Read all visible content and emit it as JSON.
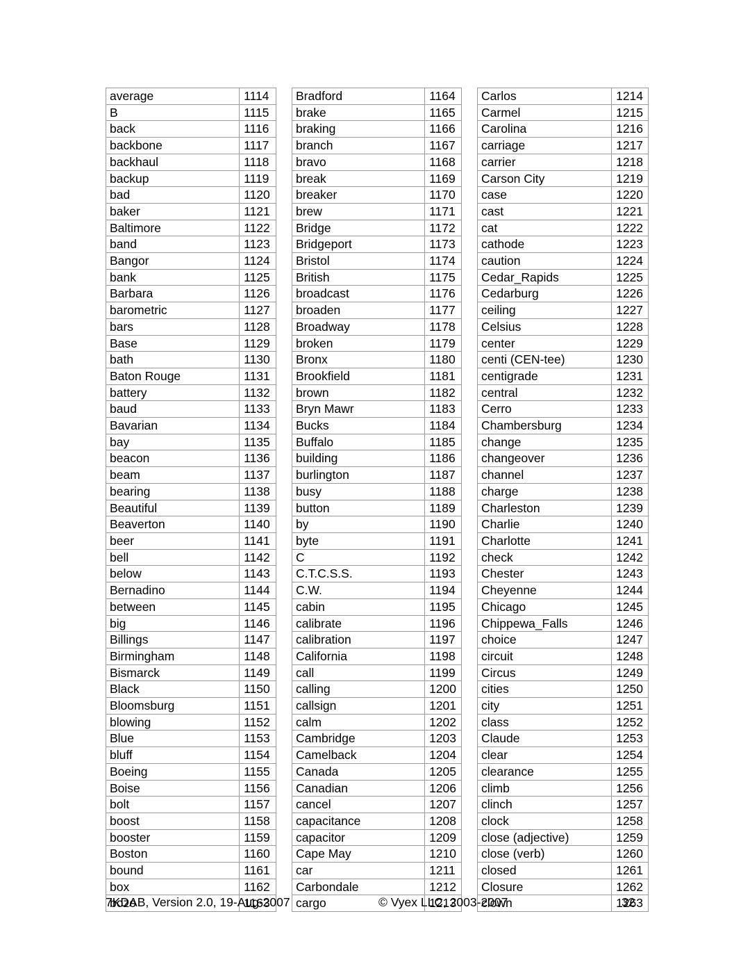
{
  "document": {
    "page_number": "32",
    "footer": {
      "left": "7KDAB, Version 2.0, 19-Aug-2007",
      "center": "© Vyex LLC, 2003-2007",
      "right": "32"
    }
  },
  "columns": [
    {
      "id": "column-1",
      "rows": [
        {
          "term": "average",
          "code": "1114"
        },
        {
          "term": "B",
          "code": "1115"
        },
        {
          "term": "back",
          "code": "1116"
        },
        {
          "term": "backbone",
          "code": "1117"
        },
        {
          "term": "backhaul",
          "code": "1118"
        },
        {
          "term": "backup",
          "code": "1119"
        },
        {
          "term": "bad",
          "code": "1120"
        },
        {
          "term": "baker",
          "code": "1121"
        },
        {
          "term": "Baltimore",
          "code": "1122"
        },
        {
          "term": "band",
          "code": "1123"
        },
        {
          "term": "Bangor",
          "code": "1124"
        },
        {
          "term": "bank",
          "code": "1125"
        },
        {
          "term": "Barbara",
          "code": "1126"
        },
        {
          "term": "barometric",
          "code": "1127"
        },
        {
          "term": "bars",
          "code": "1128"
        },
        {
          "term": "Base",
          "code": "1129"
        },
        {
          "term": "bath",
          "code": "1130"
        },
        {
          "term": "Baton Rouge",
          "code": "1131"
        },
        {
          "term": "battery",
          "code": "1132"
        },
        {
          "term": "baud",
          "code": "1133"
        },
        {
          "term": "Bavarian",
          "code": "1134"
        },
        {
          "term": "bay",
          "code": "1135"
        },
        {
          "term": "beacon",
          "code": "1136"
        },
        {
          "term": "beam",
          "code": "1137"
        },
        {
          "term": "bearing",
          "code": "1138"
        },
        {
          "term": "Beautiful",
          "code": "1139"
        },
        {
          "term": "Beaverton",
          "code": "1140"
        },
        {
          "term": "beer",
          "code": "1141"
        },
        {
          "term": "bell",
          "code": "1142"
        },
        {
          "term": "below",
          "code": "1143"
        },
        {
          "term": "Bernadino",
          "code": "1144"
        },
        {
          "term": "between",
          "code": "1145"
        },
        {
          "term": "big",
          "code": "1146"
        },
        {
          "term": "Billings",
          "code": "1147"
        },
        {
          "term": "Birmingham",
          "code": "1148"
        },
        {
          "term": "Bismarck",
          "code": "1149"
        },
        {
          "term": "Black",
          "code": "1150"
        },
        {
          "term": "Bloomsburg",
          "code": "1151"
        },
        {
          "term": "blowing",
          "code": "1152"
        },
        {
          "term": "Blue",
          "code": "1153"
        },
        {
          "term": "bluff",
          "code": "1154"
        },
        {
          "term": "Boeing",
          "code": "1155"
        },
        {
          "term": "Boise",
          "code": "1156"
        },
        {
          "term": "bolt",
          "code": "1157"
        },
        {
          "term": "boost",
          "code": "1158"
        },
        {
          "term": "booster",
          "code": "1159"
        },
        {
          "term": "Boston",
          "code": "1160"
        },
        {
          "term": "bound",
          "code": "1161"
        },
        {
          "term": "box",
          "code": "1162"
        },
        {
          "term": "bozo",
          "code": "1163"
        }
      ]
    },
    {
      "id": "column-2",
      "rows": [
        {
          "term": "Bradford",
          "code": "1164"
        },
        {
          "term": "brake",
          "code": "1165"
        },
        {
          "term": "braking",
          "code": "1166"
        },
        {
          "term": "branch",
          "code": "1167"
        },
        {
          "term": "bravo",
          "code": "1168"
        },
        {
          "term": "break",
          "code": "1169"
        },
        {
          "term": "breaker",
          "code": "1170"
        },
        {
          "term": "brew",
          "code": "1171"
        },
        {
          "term": "Bridge",
          "code": "1172"
        },
        {
          "term": "Bridgeport",
          "code": "1173"
        },
        {
          "term": "Bristol",
          "code": "1174"
        },
        {
          "term": "British",
          "code": "1175"
        },
        {
          "term": "broadcast",
          "code": "1176"
        },
        {
          "term": "broaden",
          "code": "1177"
        },
        {
          "term": "Broadway",
          "code": "1178"
        },
        {
          "term": "broken",
          "code": "1179"
        },
        {
          "term": "Bronx",
          "code": "1180"
        },
        {
          "term": "Brookfield",
          "code": "1181"
        },
        {
          "term": "brown",
          "code": "1182"
        },
        {
          "term": "Bryn Mawr",
          "code": "1183"
        },
        {
          "term": "Bucks",
          "code": "1184"
        },
        {
          "term": "Buffalo",
          "code": "1185"
        },
        {
          "term": "building",
          "code": "1186"
        },
        {
          "term": "burlington",
          "code": "1187"
        },
        {
          "term": "busy",
          "code": "1188"
        },
        {
          "term": "button",
          "code": "1189"
        },
        {
          "term": "by",
          "code": "1190"
        },
        {
          "term": "byte",
          "code": "1191"
        },
        {
          "term": "C",
          "code": "1192"
        },
        {
          "term": "C.T.C.S.S.",
          "code": "1193"
        },
        {
          "term": "C.W.",
          "code": "1194"
        },
        {
          "term": "cabin",
          "code": "1195"
        },
        {
          "term": "calibrate",
          "code": "1196"
        },
        {
          "term": "calibration",
          "code": "1197"
        },
        {
          "term": "California",
          "code": "1198"
        },
        {
          "term": "call",
          "code": "1199"
        },
        {
          "term": "calling",
          "code": "1200"
        },
        {
          "term": "callsign",
          "code": "1201"
        },
        {
          "term": "calm",
          "code": "1202"
        },
        {
          "term": "Cambridge",
          "code": "1203"
        },
        {
          "term": "Camelback",
          "code": "1204"
        },
        {
          "term": "Canada",
          "code": "1205"
        },
        {
          "term": "Canadian",
          "code": "1206"
        },
        {
          "term": "cancel",
          "code": "1207"
        },
        {
          "term": "capacitance",
          "code": "1208"
        },
        {
          "term": "capacitor",
          "code": "1209"
        },
        {
          "term": "Cape May",
          "code": "1210"
        },
        {
          "term": "car",
          "code": "1211"
        },
        {
          "term": "Carbondale",
          "code": "1212"
        },
        {
          "term": "cargo",
          "code": "1213"
        }
      ]
    },
    {
      "id": "column-3",
      "rows": [
        {
          "term": "Carlos",
          "code": "1214"
        },
        {
          "term": "Carmel",
          "code": "1215"
        },
        {
          "term": "Carolina",
          "code": "1216"
        },
        {
          "term": "carriage",
          "code": "1217"
        },
        {
          "term": "carrier",
          "code": "1218"
        },
        {
          "term": "Carson City",
          "code": "1219"
        },
        {
          "term": "case",
          "code": "1220"
        },
        {
          "term": "cast",
          "code": "1221"
        },
        {
          "term": "cat",
          "code": "1222"
        },
        {
          "term": "cathode",
          "code": "1223"
        },
        {
          "term": "caution",
          "code": "1224"
        },
        {
          "term": "Cedar_Rapids",
          "code": "1225"
        },
        {
          "term": "Cedarburg",
          "code": "1226"
        },
        {
          "term": "ceiling",
          "code": "1227"
        },
        {
          "term": "Celsius",
          "code": "1228"
        },
        {
          "term": "center",
          "code": "1229"
        },
        {
          "term": "centi (CEN-tee)",
          "code": "1230"
        },
        {
          "term": "centigrade",
          "code": "1231"
        },
        {
          "term": "central",
          "code": "1232"
        },
        {
          "term": "Cerro",
          "code": "1233"
        },
        {
          "term": "Chambersburg",
          "code": "1234"
        },
        {
          "term": "change",
          "code": "1235"
        },
        {
          "term": "changeover",
          "code": "1236"
        },
        {
          "term": "channel",
          "code": "1237"
        },
        {
          "term": "charge",
          "code": "1238"
        },
        {
          "term": "Charleston",
          "code": "1239"
        },
        {
          "term": "Charlie",
          "code": "1240"
        },
        {
          "term": "Charlotte",
          "code": "1241"
        },
        {
          "term": "check",
          "code": "1242"
        },
        {
          "term": "Chester",
          "code": "1243"
        },
        {
          "term": "Cheyenne",
          "code": "1244"
        },
        {
          "term": "Chicago",
          "code": "1245"
        },
        {
          "term": "Chippewa_Falls",
          "code": "1246"
        },
        {
          "term": "choice",
          "code": "1247"
        },
        {
          "term": "circuit",
          "code": "1248"
        },
        {
          "term": "Circus",
          "code": "1249"
        },
        {
          "term": "cities",
          "code": "1250"
        },
        {
          "term": "city",
          "code": "1251"
        },
        {
          "term": "class",
          "code": "1252"
        },
        {
          "term": "Claude",
          "code": "1253"
        },
        {
          "term": "clear",
          "code": "1254"
        },
        {
          "term": "clearance",
          "code": "1255"
        },
        {
          "term": "climb",
          "code": "1256"
        },
        {
          "term": "clinch",
          "code": "1257"
        },
        {
          "term": "clock",
          "code": "1258"
        },
        {
          "term": "close (adjective)",
          "code": "1259"
        },
        {
          "term": "close (verb)",
          "code": "1260"
        },
        {
          "term": "closed",
          "code": "1261"
        },
        {
          "term": "Closure",
          "code": "1262"
        },
        {
          "term": "clown",
          "code": "1263"
        }
      ]
    }
  ]
}
